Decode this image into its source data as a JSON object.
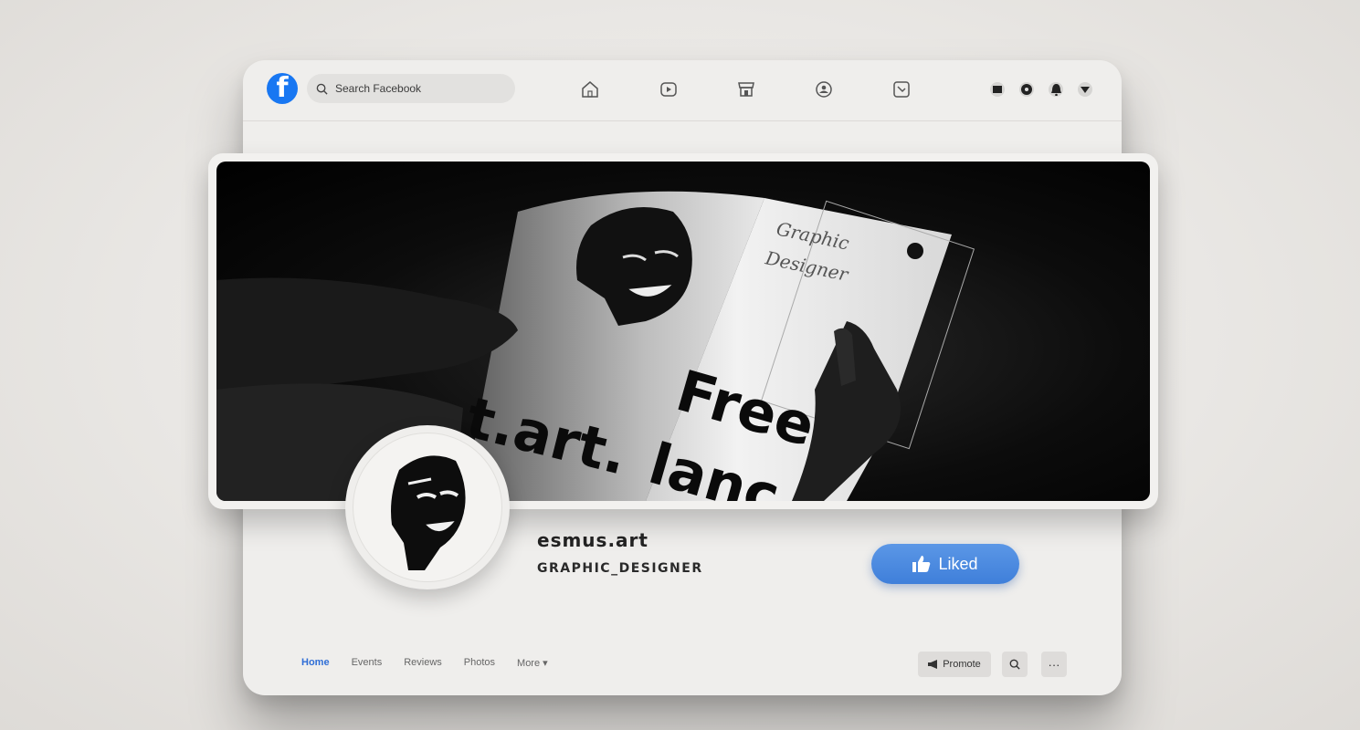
{
  "topbar": {
    "logo_letter": "f",
    "search_placeholder": "Search Facebook",
    "nav_icons": [
      "home-icon",
      "watch-icon",
      "marketplace-icon",
      "groups-icon",
      "gaming-icon"
    ],
    "right_icons": [
      "menu-icon",
      "messenger-icon",
      "notifications-icon",
      "account-dropdown-icon"
    ]
  },
  "cover": {
    "title_line1": "Graphic",
    "title_line2": "Designer",
    "big_text_left": "t.art.",
    "big_text_right_1": "Free",
    "big_text_right_2": "lanc"
  },
  "page": {
    "name": "esmus.art",
    "subtitle": "GRAPHIC_DESIGNER",
    "liked_label": "Liked"
  },
  "tabs": [
    {
      "label": "Home",
      "active": true
    },
    {
      "label": "Events",
      "active": false
    },
    {
      "label": "Reviews",
      "active": false
    },
    {
      "label": "Photos",
      "active": false
    },
    {
      "label": "More ▾",
      "active": false
    }
  ],
  "actions": {
    "promote_label": "Promote",
    "search_icon": "search-icon",
    "more_icon": "more-icon",
    "more_glyph": "···"
  },
  "colors": {
    "accent": "#1877f2",
    "liked_button": "#4a88de",
    "active_tab": "#2f6ed6"
  }
}
